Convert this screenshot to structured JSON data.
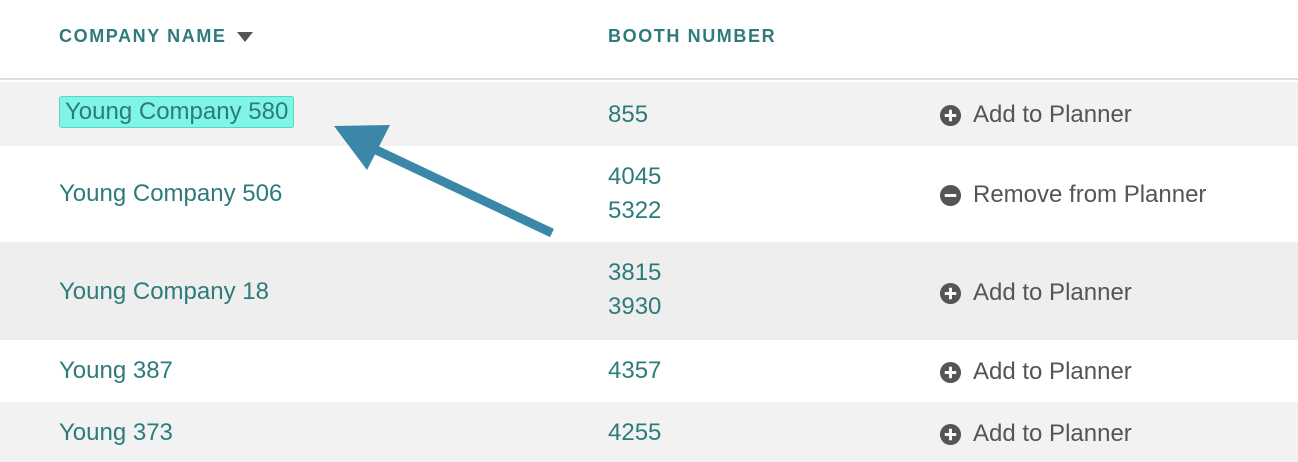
{
  "table": {
    "headers": {
      "company": "COMPANY NAME",
      "booth": "BOOTH NUMBER"
    },
    "rows": [
      {
        "company": "Young Company 580",
        "booths": [
          "855"
        ],
        "action": "Add to Planner",
        "action_icon": "plus-circle-icon",
        "highlighted": true
      },
      {
        "company": "Young Company 506",
        "booths": [
          "4045",
          "5322"
        ],
        "action": "Remove from Planner",
        "action_icon": "minus-circle-icon",
        "highlighted": false
      },
      {
        "company": "Young Company 18",
        "booths": [
          "3815",
          "3930"
        ],
        "action": "Add to Planner",
        "action_icon": "plus-circle-icon",
        "highlighted": false
      },
      {
        "company": "Young 387",
        "booths": [
          "4357"
        ],
        "action": "Add to Planner",
        "action_icon": "plus-circle-icon",
        "highlighted": false
      },
      {
        "company": "Young 373",
        "booths": [
          "4255"
        ],
        "action": "Add to Planner",
        "action_icon": "plus-circle-icon",
        "highlighted": false
      }
    ]
  },
  "colors": {
    "teal_text": "#2e7b7b",
    "highlight_bg": "#7ef5e6",
    "arrow": "#3a87a8",
    "action_text": "#555555"
  }
}
